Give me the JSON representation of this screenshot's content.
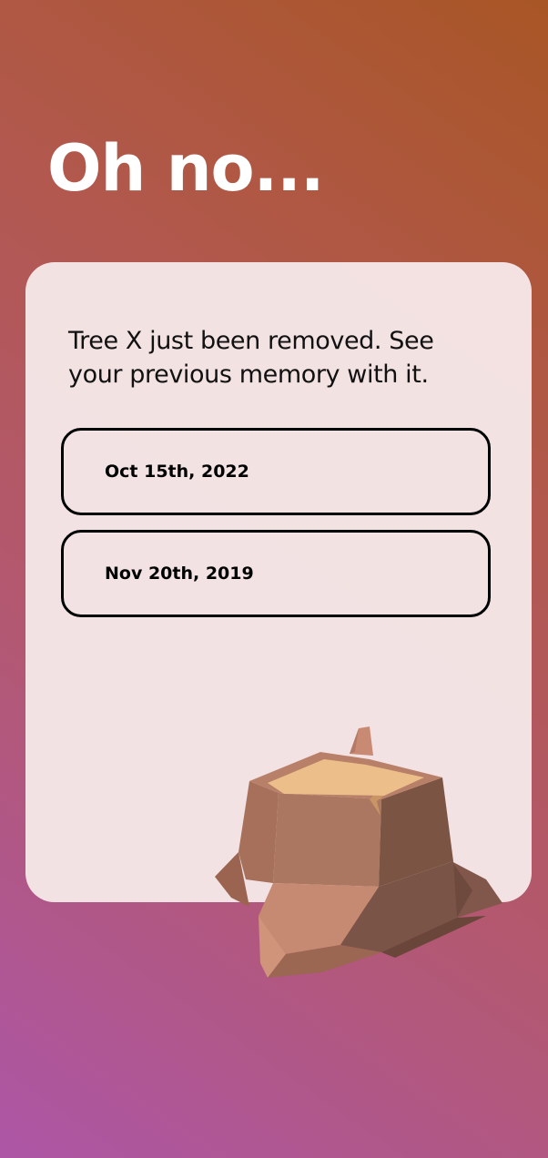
{
  "header": {
    "title": "Oh no..."
  },
  "card": {
    "message": "Tree X just been removed. See your previous memory with it.",
    "memories": [
      {
        "date": "Oct 15th, 2022"
      },
      {
        "date": "Nov 20th, 2019"
      }
    ]
  },
  "illustration": {
    "icon": "tree-stump-illustration"
  },
  "colors": {
    "background_top": "#a95626",
    "background_bottom": "#ad56a6",
    "card": "#f4e6e6",
    "stump_top": "#ecbf8a",
    "stump_side": "#a8735a"
  }
}
